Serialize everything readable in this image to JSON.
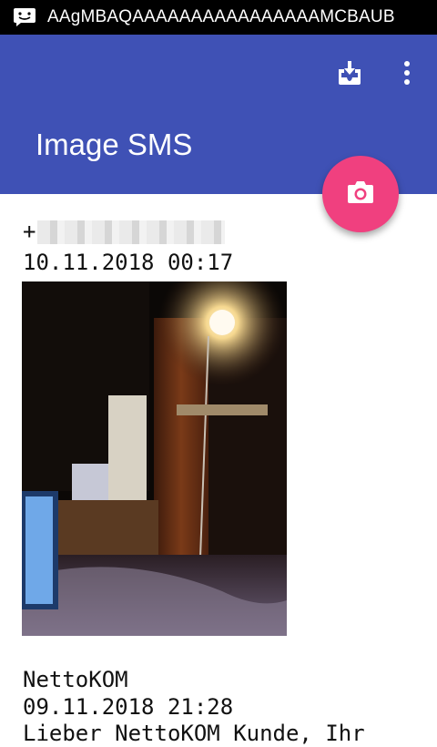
{
  "status_bar": {
    "notification_icon": "chat-bubble-icon",
    "text": "AAgMBAQAAAAAAAAAAAAAAAAMCBAUB"
  },
  "app_bar": {
    "title": "Image SMS",
    "actions": [
      {
        "name": "download-icon",
        "label": "Download"
      },
      {
        "name": "more-vert-icon",
        "label": "More options"
      }
    ]
  },
  "fab": {
    "icon": "camera-icon",
    "color": "#f0407f"
  },
  "colors": {
    "primary": "#3f51b5",
    "accent": "#f0407f"
  },
  "messages": [
    {
      "sender": "+",
      "sender_redacted": true,
      "timestamp": "10.11.2018 00:17",
      "has_image": true
    },
    {
      "sender": "NettoKOM",
      "timestamp": "09.11.2018 21:28",
      "preview": "Lieber NettoKOM Kunde, Ihr"
    }
  ]
}
